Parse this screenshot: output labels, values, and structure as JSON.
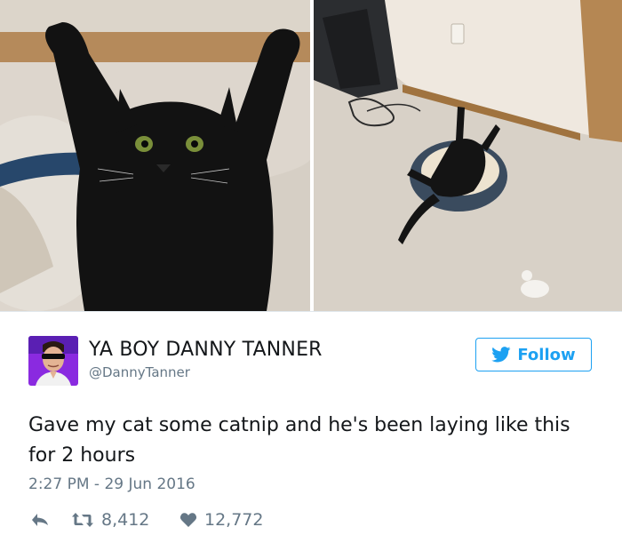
{
  "photos": [
    {
      "icon": "black-cat-arms-raised-closeup-photo"
    },
    {
      "icon": "black-cat-on-back-in-pet-bed-photo"
    }
  ],
  "author": {
    "display_name": "YA BOY DANNY TANNER",
    "handle": "@DannyTanner",
    "avatar_icon": "man-with-sunglasses-avatar"
  },
  "follow_button": {
    "label": "Follow",
    "icon": "twitter-bird-icon"
  },
  "tweet": {
    "text": "Gave my cat some catnip and he's been laying like this for 2 hours",
    "timestamp": "2:27 PM - 29 Jun 2016"
  },
  "actions": {
    "reply_icon": "reply-arrow-icon",
    "retweet_icon": "retweet-icon",
    "retweet_count": "8,412",
    "like_icon": "heart-icon",
    "like_count": "12,772"
  },
  "colors": {
    "accent": "#1da1f2",
    "text": "#14171a",
    "secondary": "#657786",
    "divider": "#e1e8ed"
  }
}
